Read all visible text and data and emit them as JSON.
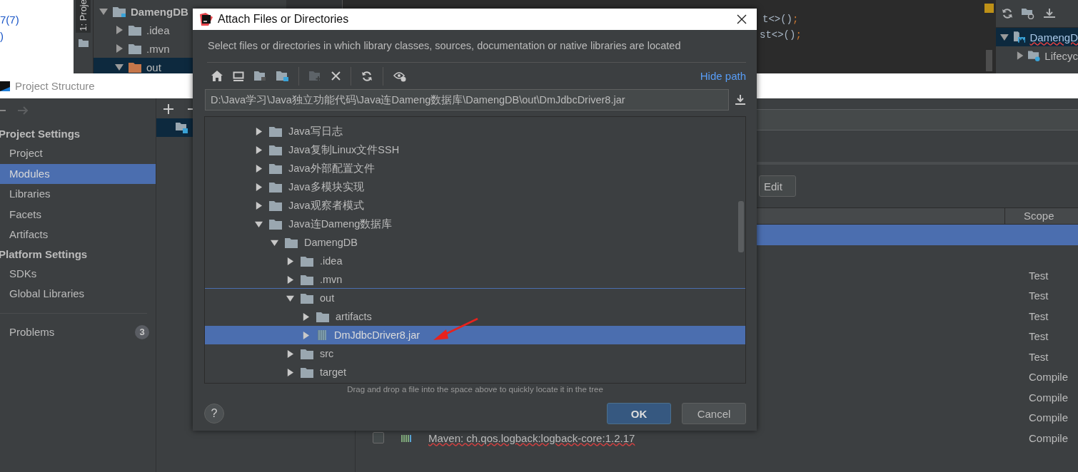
{
  "ide": {
    "browser_text": [
      "7(7)",
      ")"
    ],
    "tool_window_tab": "1: Proje",
    "project_tree": [
      {
        "label": "DamengDB",
        "kind": "module",
        "expanded": true,
        "selected": false,
        "children": [
          {
            "label": ".idea",
            "kind": "folder",
            "expanded": false,
            "selected": false
          },
          {
            "label": ".mvn",
            "kind": "folder",
            "expanded": false,
            "selected": false
          },
          {
            "label": "out",
            "kind": "excluded",
            "expanded": true,
            "selected": true
          }
        ]
      }
    ],
    "code_lines": [
      [
        {
          "text": "t<>()",
          "kind": "plain"
        },
        {
          "text": ";",
          "kind": "keyword"
        }
      ],
      [
        {
          "text": "st<>()",
          "kind": "plain"
        },
        {
          "text": ";",
          "kind": "keyword"
        }
      ]
    ],
    "maven_tree": [
      {
        "label": "DamengD",
        "kind": "project",
        "expanded": true,
        "selected": true,
        "children": [
          {
            "label": "Lifecyc",
            "kind": "lifecycle",
            "expanded": false,
            "selected": false
          }
        ]
      }
    ]
  },
  "project_structure": {
    "title": "Project Structure",
    "sections": [
      {
        "heading": "Project Settings",
        "items": [
          {
            "label": "Project",
            "selected": false
          },
          {
            "label": "Modules",
            "selected": true
          },
          {
            "label": "Libraries",
            "selected": false
          },
          {
            "label": "Facets",
            "selected": false
          },
          {
            "label": "Artifacts",
            "selected": false
          }
        ]
      },
      {
        "heading": "Platform Settings",
        "items": [
          {
            "label": "SDKs",
            "selected": false
          },
          {
            "label": "Global Libraries",
            "selected": false
          }
        ]
      }
    ],
    "problems": {
      "label": "Problems",
      "count": "3"
    },
    "modules": [
      {
        "selected": true
      }
    ],
    "edit_button": "Edit",
    "table": {
      "scope_header": "Scope",
      "rows": [
        {
          "selected": true
        },
        {
          "selected": false
        },
        {
          "scope": "Test",
          "selected": false
        },
        {
          "scope": "Test",
          "selected": false
        },
        {
          "scope": "Test",
          "selected": false
        },
        {
          "scope": "Test",
          "selected": false
        },
        {
          "scope": "Test",
          "selected": false
        },
        {
          "scope": "Compile",
          "selected": false
        },
        {
          "scope": "Compile",
          "selected": false
        },
        {
          "scope": "Compile",
          "selected": false
        },
        {
          "scope": "Compile",
          "selected": false,
          "checked": false,
          "name": "Maven: ch.qos.logback:logback-core:1.2.17"
        }
      ]
    }
  },
  "dialog": {
    "title": "Attach Files or Directories",
    "description": "Select files or directories in which library classes, sources, documentation or native libraries are located",
    "toolbar": [
      {
        "kind": "home",
        "disabled": false
      },
      {
        "kind": "desktop",
        "disabled": false
      },
      {
        "kind": "module",
        "disabled": false
      },
      {
        "kind": "project",
        "disabled": false
      },
      {
        "kind": "separator"
      },
      {
        "kind": "new-folder",
        "disabled": true
      },
      {
        "kind": "delete",
        "disabled": false
      },
      {
        "kind": "separator"
      },
      {
        "kind": "refresh",
        "disabled": false
      },
      {
        "kind": "separator"
      },
      {
        "kind": "hidden",
        "disabled": false
      }
    ],
    "hide_path": "Hide path",
    "path": "D:\\Java学习\\Java独立功能代码\\Java连Dameng数据库\\DamengDB\\out\\DmJdbcDriver8.jar",
    "tree": [
      {
        "label": "Java写日志",
        "kind": "folder",
        "expanded": false,
        "selected": false
      },
      {
        "label": "Java复制Linux文件SSH",
        "kind": "folder",
        "expanded": false,
        "selected": false
      },
      {
        "label": "Java外部配置文件",
        "kind": "folder",
        "expanded": false,
        "selected": false
      },
      {
        "label": "Java多模块实现",
        "kind": "folder",
        "expanded": false,
        "selected": false
      },
      {
        "label": "Java观察者模式",
        "kind": "folder",
        "expanded": false,
        "selected": false
      },
      {
        "label": "Java连Dameng数据库",
        "kind": "folder",
        "expanded": true,
        "selected": false,
        "children": [
          {
            "label": "DamengDB",
            "kind": "folder",
            "expanded": true,
            "selected": false,
            "children": [
              {
                "label": ".idea",
                "kind": "folder",
                "expanded": false,
                "selected": false
              },
              {
                "label": ".mvn",
                "kind": "folder",
                "expanded": false,
                "selected": false
              },
              {
                "label": "out",
                "kind": "folder",
                "expanded": true,
                "selected": false,
                "children": [
                  {
                    "label": "artifacts",
                    "kind": "folder",
                    "expanded": false,
                    "selected": false
                  },
                  {
                    "label": "DmJdbcDriver8.jar",
                    "kind": "jar",
                    "expanded": false,
                    "selected": true
                  }
                ]
              },
              {
                "label": "src",
                "kind": "folder",
                "expanded": false,
                "selected": false
              },
              {
                "label": "target",
                "kind": "folder",
                "expanded": false,
                "selected": false
              }
            ]
          }
        ]
      }
    ],
    "hint": "Drag and drop a file into the space above to quickly locate it in the tree",
    "help": "?",
    "buttons": [
      {
        "label": "OK",
        "kind": "primary"
      },
      {
        "label": "Cancel",
        "kind": "secondary"
      }
    ]
  }
}
